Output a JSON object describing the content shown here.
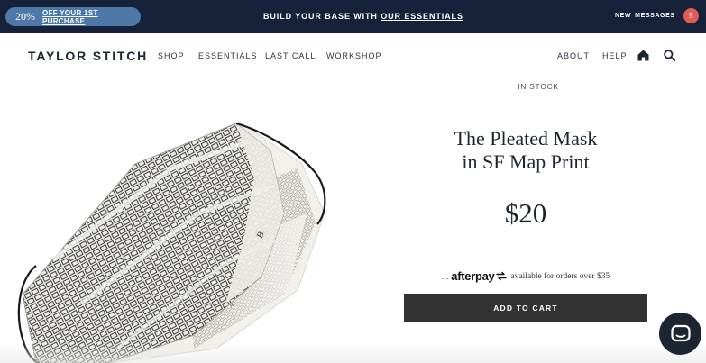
{
  "promo": {
    "percent": "20%",
    "link_label": "OFF YOUR 1ST PURCHASE"
  },
  "announcement": {
    "text": "BUILD YOUR BASE WITH ",
    "link_label": "OUR ESSENTIALS"
  },
  "messages": {
    "new_label": "NEW",
    "messages_label": "MESSAGES",
    "count": "5"
  },
  "header": {
    "logo": "TAYLOR STITCH",
    "nav_left": [
      {
        "label": "SHOP"
      },
      {
        "label": "ESSENTIALS"
      },
      {
        "label": "LAST CALL"
      },
      {
        "label": "WORKSHOP"
      }
    ],
    "nav_right": [
      {
        "label": "ABOUT"
      },
      {
        "label": "HELP"
      }
    ],
    "icons": [
      "home-icon",
      "search-icon"
    ]
  },
  "product": {
    "stock_status": "IN STOCK",
    "title_line1": "The Pleated Mask",
    "title_line2": "in SF Map Print",
    "price": "$20",
    "afterpay_prefix": "...",
    "afterpay_brand": "afterpay",
    "afterpay_note": "available for orders over $35",
    "add_to_cart_label": "ADD TO CART",
    "image_icon": "face-mask-sf-map-print-image"
  },
  "chat": {
    "icon": "chat-bubble-icon"
  },
  "colors": {
    "topbar_bg": "#16223a",
    "promo_pill": "#4d78a8",
    "badge": "#e25c52",
    "button_bg": "#323232",
    "text_dark": "#1d2530"
  }
}
